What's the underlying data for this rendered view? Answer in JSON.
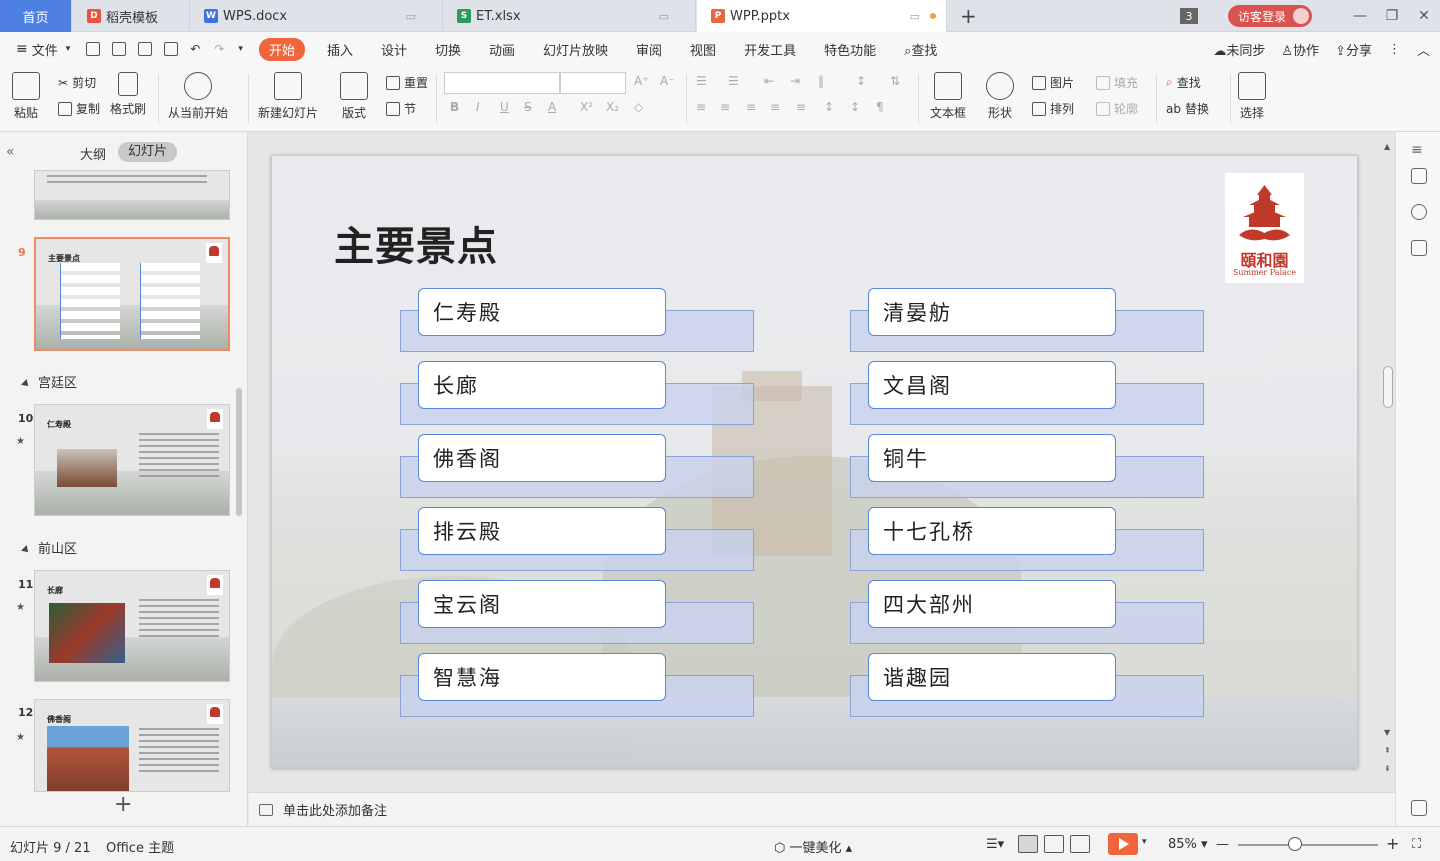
{
  "tabs": {
    "home": "首页",
    "items": [
      {
        "label": "稻壳模板",
        "color": "#e8553c",
        "glyph": "D"
      },
      {
        "label": "WPS.docx",
        "color": "#3f73d9",
        "glyph": "W"
      },
      {
        "label": "ET.xlsx",
        "color": "#2a9d5a",
        "glyph": "S"
      },
      {
        "label": "WPP.pptx",
        "color": "#e9683f",
        "glyph": "P"
      }
    ],
    "count": "3",
    "visitor_login": "访客登录"
  },
  "menu": {
    "file": "文件",
    "items": [
      "开始",
      "插入",
      "设计",
      "切换",
      "动画",
      "幻灯片放映",
      "审阅",
      "视图",
      "开发工具",
      "特色功能"
    ],
    "active": "开始",
    "search": "查找",
    "sync": "未同步",
    "collab": "协作",
    "share": "分享"
  },
  "ribbon": {
    "paste": "粘贴",
    "cut": "剪切",
    "copy": "复制",
    "format_painter": "格式刷",
    "from_current": "从当前开始",
    "new_slide": "新建幻灯片",
    "layout": "版式",
    "reset": "重置",
    "section": "节",
    "textbox": "文本框",
    "shape": "形状",
    "picture": "图片",
    "fill": "填充",
    "arrange": "排列",
    "outline": "轮廓",
    "find": "查找",
    "replace": "替换",
    "select": "选择"
  },
  "left_panel": {
    "tab_outline": "大纲",
    "tab_slides": "幻灯片",
    "sections": [
      "宫廷区",
      "前山区"
    ],
    "slides": [
      {
        "num": "9",
        "title": "主要景点"
      },
      {
        "num": "10",
        "title": "仁寿殿"
      },
      {
        "num": "11",
        "title": "长廊"
      },
      {
        "num": "12",
        "title": "佛香阁"
      }
    ]
  },
  "slide": {
    "title": "主要景点",
    "logo_cn": "頤和園",
    "logo_en": "Summer Palace",
    "left_items": [
      "仁寿殿",
      "长廊",
      "佛香阁",
      "排云殿",
      "宝云阁",
      "智慧海"
    ],
    "right_items": [
      "清晏舫",
      "文昌阁",
      "铜牛",
      "十七孔桥",
      "四大部州",
      "谐趣园"
    ]
  },
  "notes_placeholder": "单击此处添加备注",
  "status": {
    "slide_info": "幻灯片 9 / 21",
    "theme": "Office 主题",
    "beautify": "一键美化",
    "zoom": "85%"
  }
}
